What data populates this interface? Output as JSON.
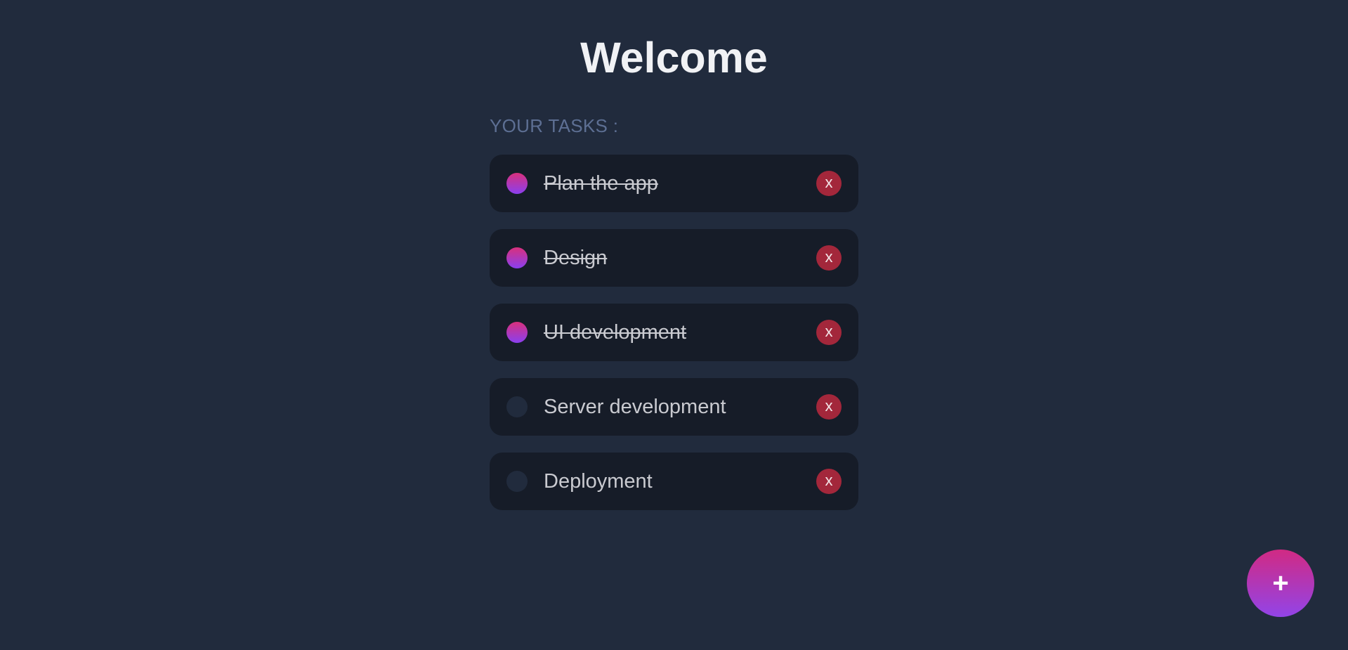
{
  "header": {
    "title": "Welcome"
  },
  "tasks_section": {
    "heading": "YOUR TASKS :",
    "items": [
      {
        "label": "Plan the app",
        "done": true,
        "delete_label": "x"
      },
      {
        "label": "Design",
        "done": true,
        "delete_label": "x"
      },
      {
        "label": "UI development",
        "done": true,
        "delete_label": "x"
      },
      {
        "label": "Server development",
        "done": false,
        "delete_label": "x"
      },
      {
        "label": "Deployment",
        "done": false,
        "delete_label": "x"
      }
    ]
  },
  "fab": {
    "label": "+",
    "icon": "plus-icon"
  },
  "colors": {
    "background": "#212b3d",
    "card": "#161c28",
    "delete": "#a3273b",
    "accent_start": "#d8307c",
    "accent_end": "#8a3ff0",
    "heading_muted": "#5d6f93"
  }
}
